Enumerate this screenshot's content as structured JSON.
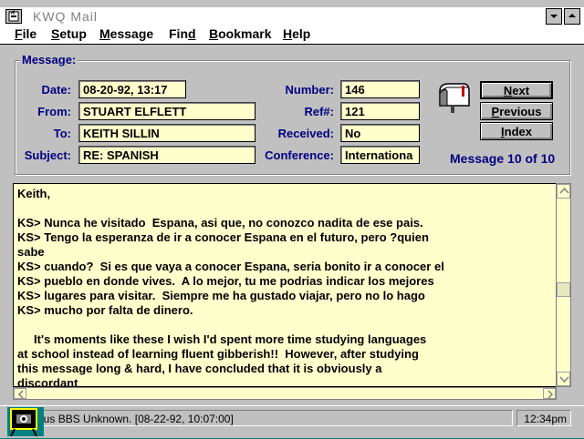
{
  "window": {
    "title": "KWQ Mail"
  },
  "menu": [
    {
      "label": "File",
      "underline": "F",
      "rest": "ile"
    },
    {
      "label": "Setup",
      "underline": "S",
      "rest": "etup"
    },
    {
      "label": "Message",
      "underline": "M",
      "rest": "essage"
    },
    {
      "label": "Find",
      "pre": "Fin",
      "underline": "d",
      "rest": ""
    },
    {
      "label": "Bookmark",
      "underline": "B",
      "rest": "ookmark"
    },
    {
      "label": "Help",
      "underline": "H",
      "rest": "elp"
    }
  ],
  "message": {
    "group_title": "Message:",
    "labels": {
      "date": "Date:",
      "from": "From:",
      "to": "To:",
      "subject": "Subject:",
      "number": "Number:",
      "ref": "Ref#:",
      "received": "Received:",
      "conference": "Conference:"
    },
    "values": {
      "date": "08-20-92, 13:17",
      "from": "STUART ELFLETT",
      "to": "KEITH SILLIN",
      "subject": "RE: SPANISH",
      "number": "146",
      "ref": "121",
      "received": "No",
      "conference": "Internationa"
    },
    "buttons": {
      "next": {
        "underline": "N",
        "rest": "ext"
      },
      "previous": {
        "underline": "P",
        "rest": "revious"
      },
      "index": {
        "underline": "I",
        "rest": "ndex"
      }
    },
    "counter": "Message 10 of 10"
  },
  "body_lines": [
    "Keith,",
    "",
    "KS> Nunca he visitado  Espana, asi que, no conozco nadita de ese pais.",
    "KS> Tengo la esperanza de ir a conocer Espana en el futuro, pero ?quien",
    "sabe",
    "KS> cuando?  Si es que vaya a conocer Espana, seria bonito ir a conocer el",
    "KS> pueblo en donde vives.  A lo mejor, tu me podrias indicar los mejores",
    "KS> lugares para visitar.  Siempre me ha gustado viajar, pero no lo hago",
    "KS> mucho por falta de dinero.",
    "",
    "     It's moments like these I wish I'd spent more time studying languages",
    "at school instead of learning fluent gibberish!!  However, after studying",
    "this message long & hard, I have concluded that it is obviously a",
    "discordant"
  ],
  "status": {
    "left": "Proteus BBS Unknown.  [08-22-92, 10:07:00]",
    "time": "12:34pm"
  },
  "colors": {
    "accent": "#000080",
    "field_bg": "#ffffcc",
    "desktop": "#008080"
  }
}
